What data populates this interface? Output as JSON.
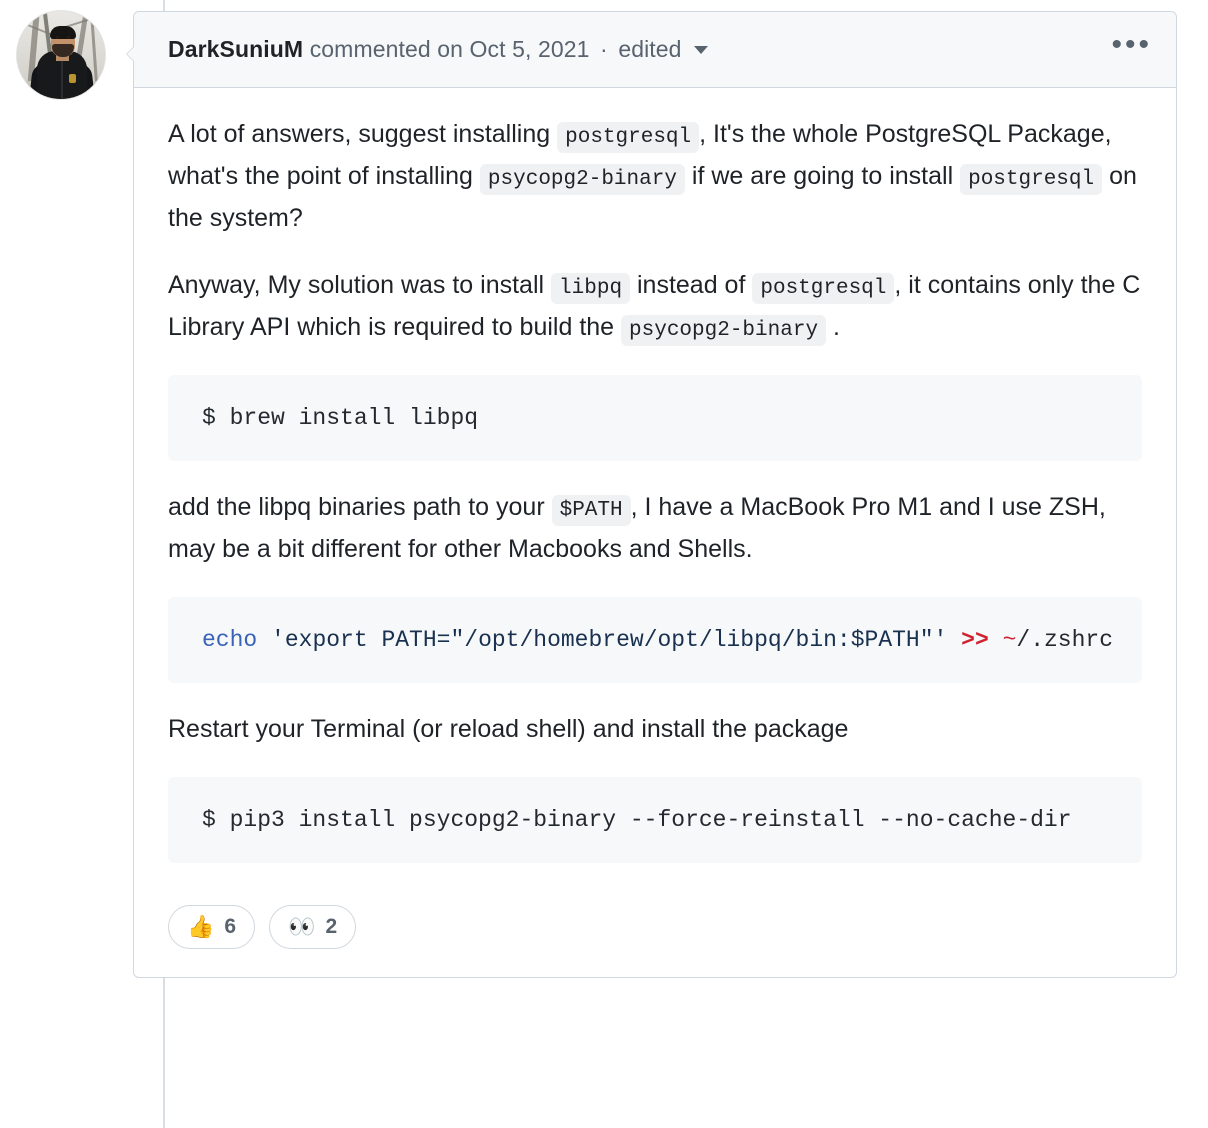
{
  "thread": {
    "avatar_alt": "DarkSuniuM avatar"
  },
  "comment": {
    "author": "DarkSuniuM",
    "action": "commented on",
    "date": "Oct 5, 2021",
    "separator": "·",
    "edited_label": "edited",
    "menu_icon": "•••",
    "paragraphs": [
      {
        "id": "p1",
        "runs": [
          {
            "type": "text",
            "value": "A lot of answers, suggest installing "
          },
          {
            "type": "code",
            "value": "postgresql"
          },
          {
            "type": "text",
            "value": ", It's the whole PostgreSQL Package, what's the point of installing "
          },
          {
            "type": "code",
            "value": "psycopg2-binary"
          },
          {
            "type": "text",
            "value": " if we are going to install "
          },
          {
            "type": "code",
            "value": "postgresql"
          },
          {
            "type": "text",
            "value": " on the system?"
          }
        ]
      },
      {
        "id": "p2",
        "runs": [
          {
            "type": "text",
            "value": "Anyway, My solution was to install "
          },
          {
            "type": "code",
            "value": "libpq"
          },
          {
            "type": "text",
            "value": " instead of "
          },
          {
            "type": "code",
            "value": "postgresql"
          },
          {
            "type": "text",
            "value": ", it contains only the C Library API which is required to build the "
          },
          {
            "type": "code",
            "value": "psycopg2-binary"
          },
          {
            "type": "text",
            "value": " ."
          }
        ]
      },
      {
        "id": "p3",
        "runs": [
          {
            "type": "text",
            "value": "add the libpq binaries path to your "
          },
          {
            "type": "code",
            "value": "$PATH"
          },
          {
            "type": "text",
            "value": ", I have a MacBook Pro M1 and I use ZSH, may be a bit different for other Macbooks and Shells."
          }
        ]
      },
      {
        "id": "p4",
        "runs": [
          {
            "type": "text",
            "value": "Restart your Terminal (or reload shell) and install the package"
          }
        ]
      }
    ],
    "code_blocks": {
      "block1": {
        "plain": "$ brew install libpq",
        "tokens": [
          {
            "class": "plain",
            "value": "$ brew install libpq"
          }
        ]
      },
      "block2": {
        "plain": "echo 'export PATH=\"/opt/homebrew/opt/libpq/bin:$PATH\"' >> ~/.zshrc",
        "tokens": [
          {
            "class": "kw",
            "value": "echo"
          },
          {
            "class": "plain",
            "value": " "
          },
          {
            "class": "str",
            "value": "'export PATH=\"/opt/homebrew/opt/libpq/bin:$PATH\"'"
          },
          {
            "class": "plain",
            "value": " "
          },
          {
            "class": "op",
            "value": ">>"
          },
          {
            "class": "plain",
            "value": " "
          },
          {
            "class": "tilde",
            "value": "~"
          },
          {
            "class": "plain",
            "value": "/.zshrc"
          }
        ]
      },
      "block3": {
        "plain": "$ pip3 install psycopg2-binary --force-reinstall --no-cache-dir",
        "tokens": [
          {
            "class": "plain",
            "value": "$ pip3 install psycopg2-binary --force-reinstall --no-cache-dir"
          }
        ]
      }
    },
    "reactions": [
      {
        "name": "thumbs-up",
        "emoji": "👍",
        "count": "6"
      },
      {
        "name": "eyes",
        "emoji": "👀",
        "count": "2"
      }
    ]
  },
  "colors": {
    "border": "#d0d7de",
    "header_bg": "#f6f8fa",
    "code_bg": "#f6f8fa",
    "inline_code_bg": "#eff1f3",
    "text": "#1F2328",
    "muted": "#59636e",
    "keyword": "#3a63b8",
    "string": "#19314f",
    "operator": "#cf222e"
  }
}
